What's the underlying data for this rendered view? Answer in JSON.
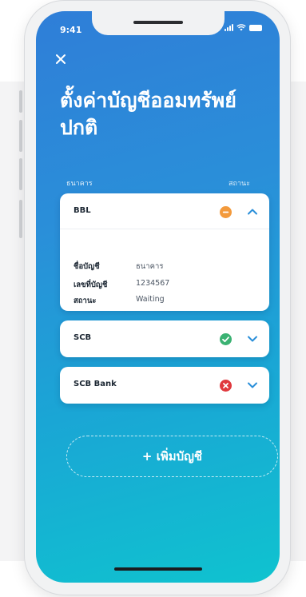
{
  "status_bar": {
    "time": "9:41"
  },
  "page": {
    "title": "ตั้งค่าบัญชีออมทรัพย์ปกติ"
  },
  "columns": {
    "bank": "ธนาคาร",
    "status": "สถานะ"
  },
  "accounts": [
    {
      "bank": "BBL",
      "status_icon": "minus-circle-icon",
      "status_color": "#f39a3c",
      "expanded": true,
      "details": [
        {
          "label": "ชื่อบัญชี",
          "value": "ธนาคาร"
        },
        {
          "label": "เลขที่บัญชี",
          "value": "1234567"
        },
        {
          "label": "สถานะ",
          "value": "Waiting"
        }
      ]
    },
    {
      "bank": "SCB",
      "status_icon": "check-circle-icon",
      "status_color": "#3bb273",
      "expanded": false
    },
    {
      "bank": "SCB Bank",
      "status_icon": "x-circle-icon",
      "status_color": "#e0393e",
      "expanded": false
    }
  ],
  "actions": {
    "add_account": "+ เพิ่มบัญชี"
  },
  "colors": {
    "gradient_top": "#2f7ed8",
    "gradient_bottom": "#0fc3cf",
    "accent": "#2a8fd9"
  }
}
